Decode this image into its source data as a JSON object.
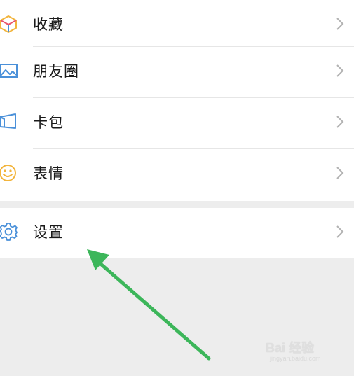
{
  "menu": {
    "items": [
      {
        "label": "收藏",
        "icon": "favorites-cube-icon"
      },
      {
        "label": "朋友圈",
        "icon": "moments-photo-icon"
      },
      {
        "label": "卡包",
        "icon": "card-wallet-icon"
      },
      {
        "label": "表情",
        "icon": "sticker-smiley-icon"
      }
    ],
    "settings": {
      "label": "设置",
      "icon": "gear-icon"
    }
  },
  "annotation": {
    "arrow_color": "#3cb65a"
  },
  "watermark": {
    "text": "Bai 经验",
    "subtext": "jingyan.baidu.com"
  },
  "colors": {
    "background": "#ededed",
    "row_background": "#ffffff",
    "label": "#1a1a1a",
    "chevron": "#b2b2b2"
  }
}
